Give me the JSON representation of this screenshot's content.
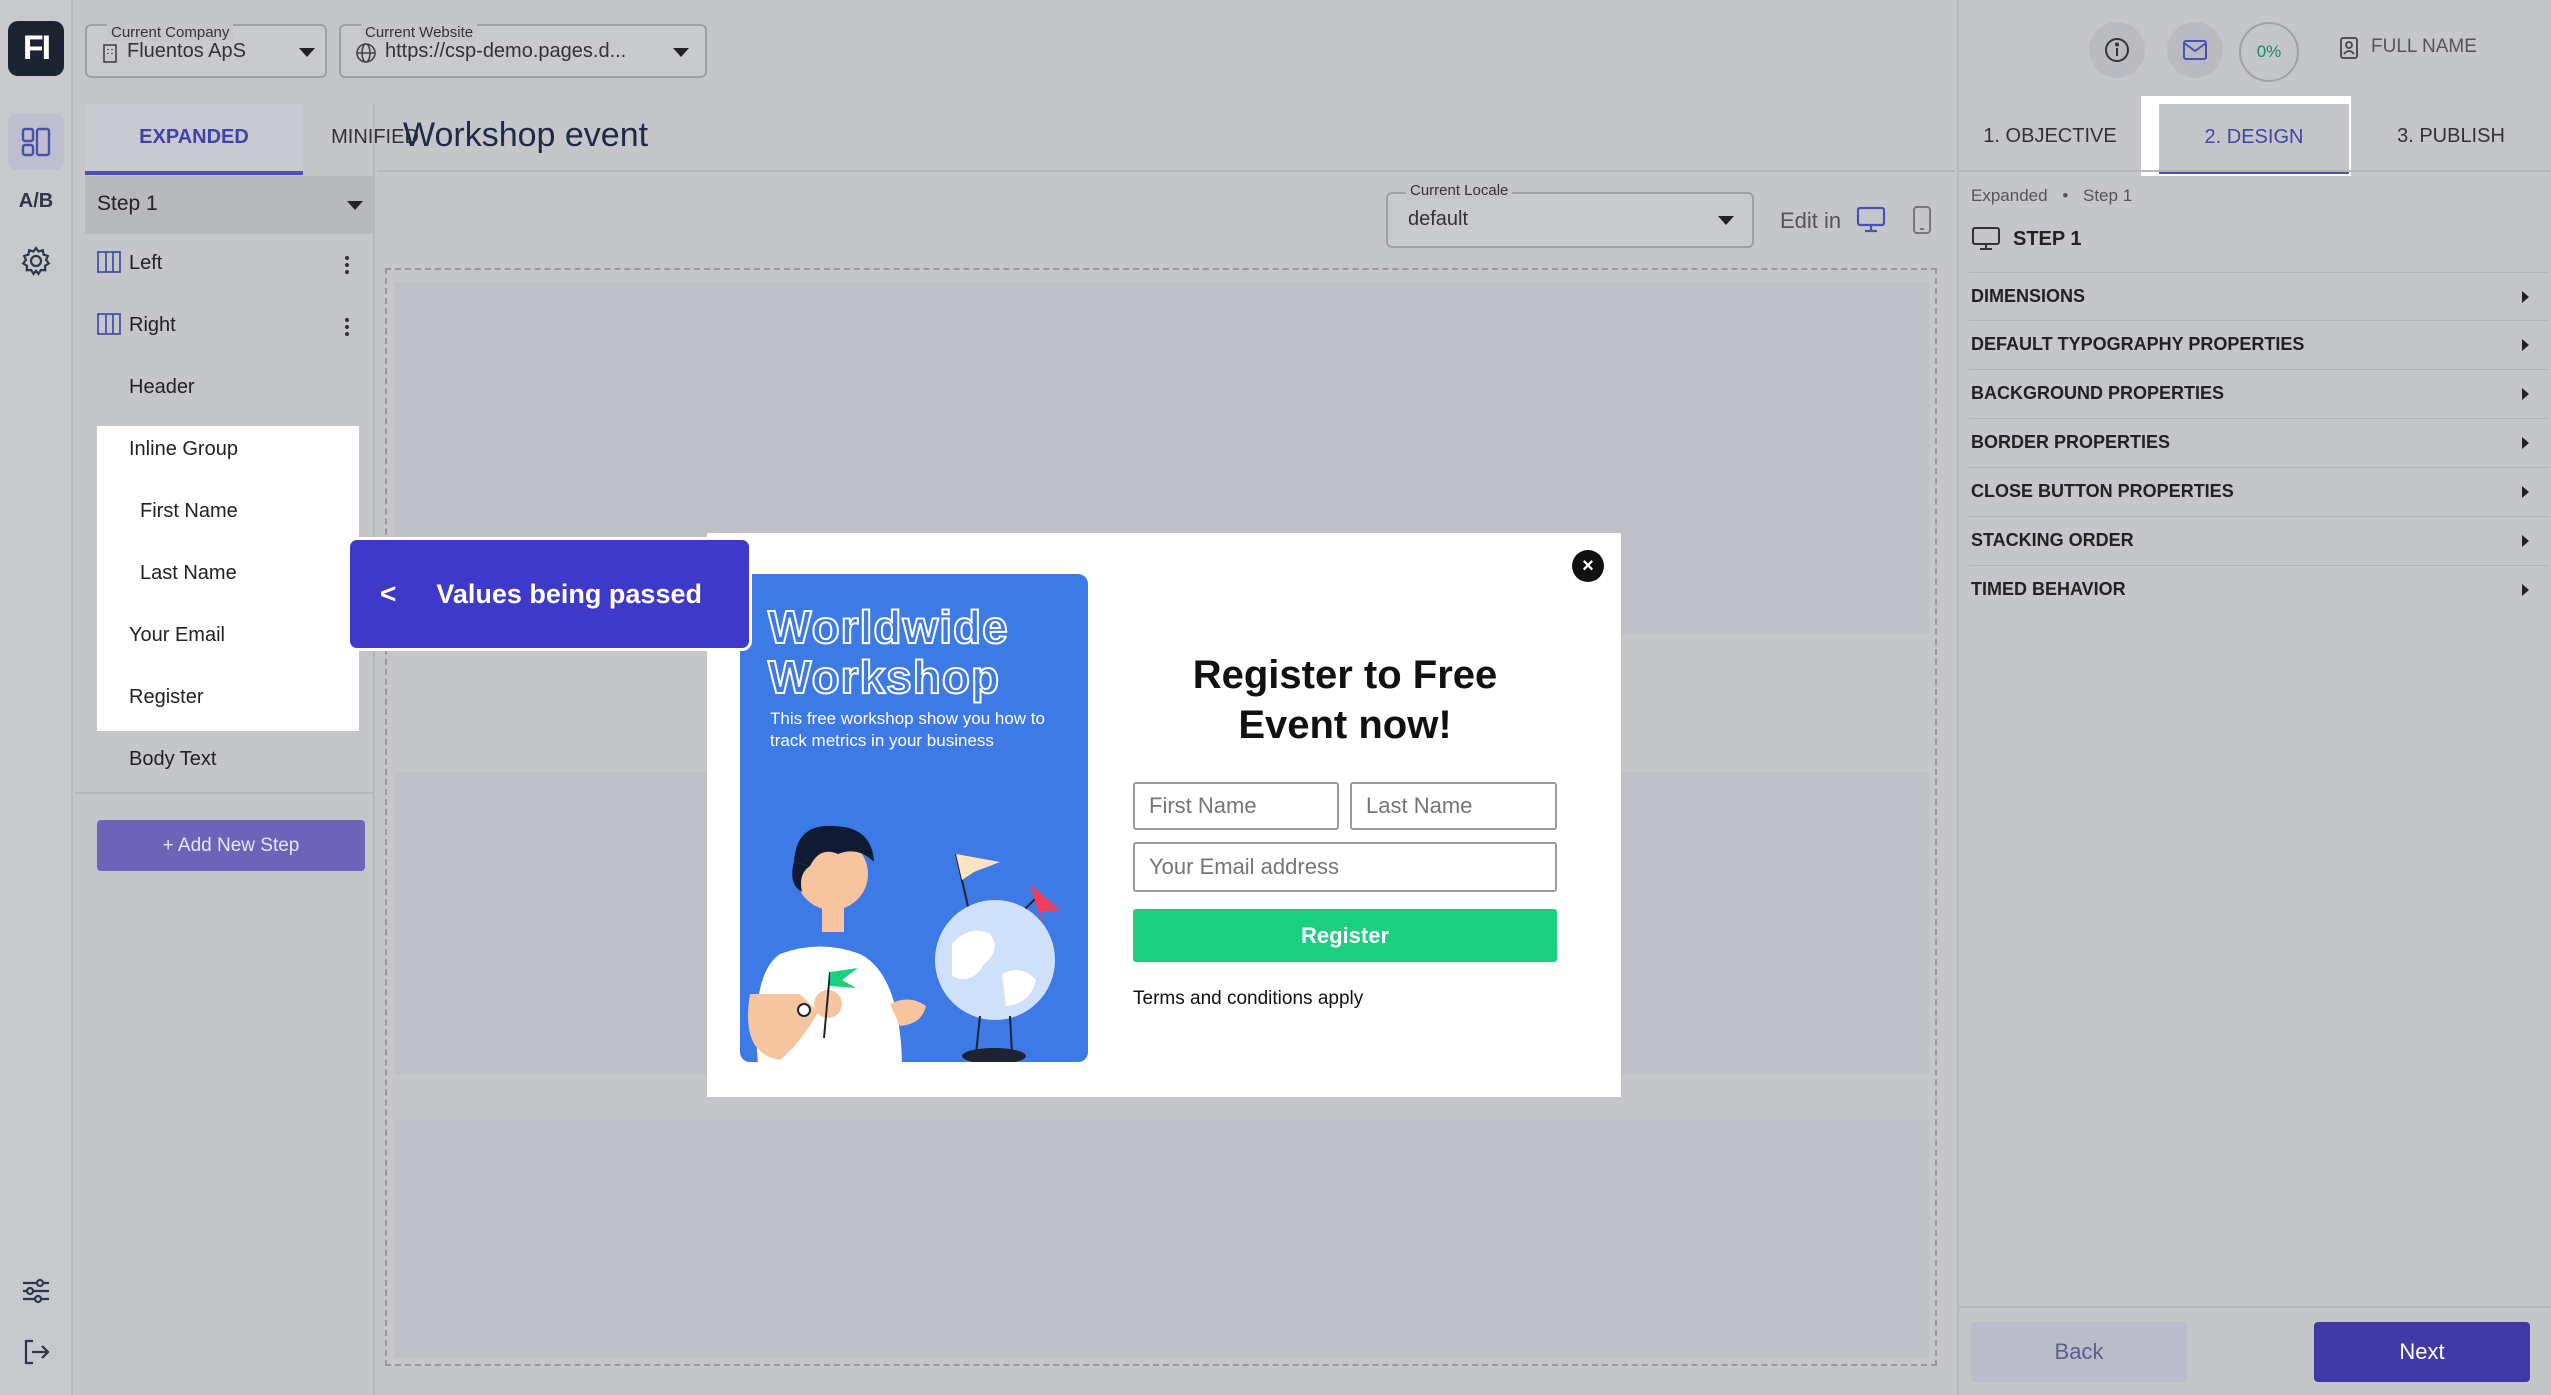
{
  "top": {
    "company_caption": "Current Company",
    "company_value": "Fluentos ApS",
    "website_caption": "Current Website",
    "website_value": "https://csp-demo.pages.d...",
    "progress": "0%",
    "full_name": "FULL NAME"
  },
  "rail": {
    "logo": "FI",
    "ab": "A/B"
  },
  "left": {
    "tabs": [
      "EXPANDED",
      "MINIFIED"
    ],
    "step": "Step 1",
    "tree": {
      "left": "Left",
      "right": "Right",
      "header": "Header",
      "inline_group": "Inline Group",
      "first_name": "First Name",
      "last_name": "Last Name",
      "your_email": "Your Email",
      "register": "Register",
      "body_text": "Body Text"
    },
    "add_step": "+ Add New Step"
  },
  "center": {
    "title": "Workshop event",
    "locale_caption": "Current Locale",
    "locale_value": "default",
    "edit_in": "Edit in"
  },
  "popup": {
    "promo_title_1": "Worldwide",
    "promo_title_2": "Workshop",
    "promo_sub": "This free workshop show you how to track metrics in your business",
    "form_title": "Register to Free Event now!",
    "first_name_placeholder": "First Name",
    "last_name_placeholder": "Last Name",
    "email_placeholder": "Your Email address",
    "register_label": "Register",
    "terms": "Terms and conditions apply",
    "close": "×"
  },
  "callout": {
    "back": "<",
    "text": "Values being passed"
  },
  "right": {
    "tabs": [
      "1. OBJECTIVE",
      "2. DESIGN",
      "3. PUBLISH"
    ],
    "breadcrumb_1": "Expanded",
    "breadcrumb_sep": "•",
    "breadcrumb_2": "Step 1",
    "step_head": "STEP 1",
    "sections": [
      "DIMENSIONS",
      "DEFAULT TYPOGRAPHY PROPERTIES",
      "BACKGROUND PROPERTIES",
      "BORDER PROPERTIES",
      "CLOSE BUTTON PROPERTIES",
      "STACKING ORDER",
      "TIMED BEHAVIOR"
    ],
    "back": "Back",
    "next": "Next"
  },
  "colors": {
    "accent": "#3f3aa5",
    "register_green": "#1ad07f",
    "promo_blue": "#3d7ae6",
    "callout": "#3f39c9"
  }
}
